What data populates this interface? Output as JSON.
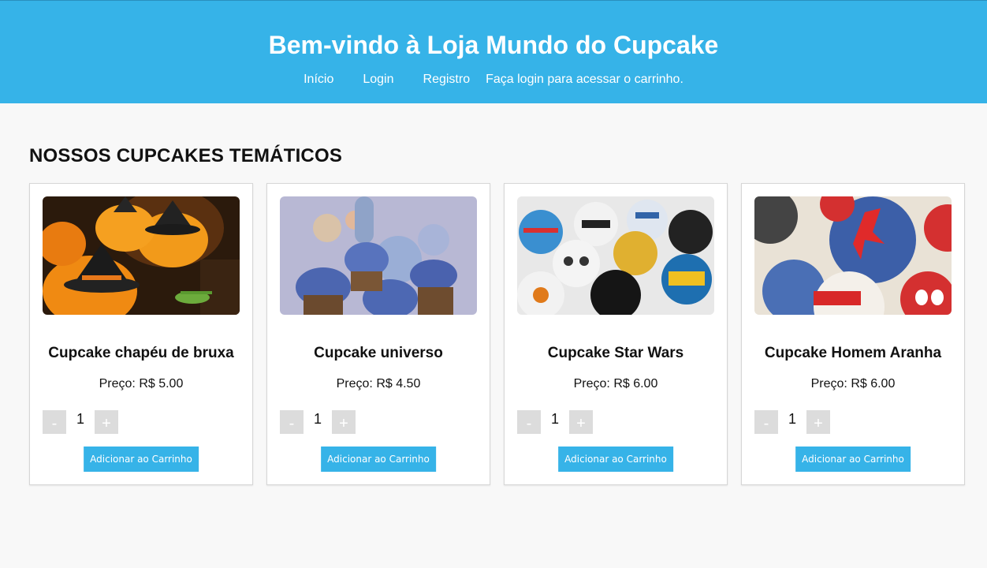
{
  "header": {
    "title": "Bem-vindo à Loja Mundo do Cupcake",
    "nav": [
      "Início",
      "Login",
      "Registro"
    ],
    "login_message": "Faça login para acessar o carrinho."
  },
  "section_title": "NOSSOS CUPCAKES TEMÁTICOS",
  "products": [
    {
      "name": "Cupcake chapéu de bruxa",
      "price": "Preço: R$ 5.00",
      "qty": "1",
      "minus": "-",
      "plus": "+",
      "add_label": "Adicionar ao Carrinho"
    },
    {
      "name": "Cupcake universo",
      "price": "Preço: R$ 4.50",
      "qty": "1",
      "minus": "-",
      "plus": "+",
      "add_label": "Adicionar ao Carrinho"
    },
    {
      "name": "Cupcake Star Wars",
      "price": "Preço: R$ 6.00",
      "qty": "1",
      "minus": "-",
      "plus": "+",
      "add_label": "Adicionar ao Carrinho"
    },
    {
      "name": "Cupcake Homem Aranha",
      "price": "Preço: R$ 6.00",
      "qty": "1",
      "minus": "-",
      "plus": "+",
      "add_label": "Adicionar ao Carrinho"
    }
  ],
  "colors": {
    "accent": "#36b3e8",
    "qty_button": "#dcdcdc",
    "background": "#f8f8f8"
  }
}
